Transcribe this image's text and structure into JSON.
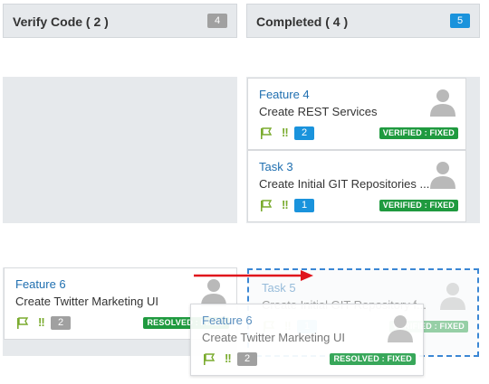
{
  "columns": [
    {
      "title": "Verify Code ( 2 )",
      "count": "4"
    },
    {
      "title": "Completed ( 4 )",
      "count": "5"
    }
  ],
  "completed_cards": [
    {
      "title": "Feature 4",
      "description": "Create REST Services",
      "points": "2",
      "status": "VERIFIED : FIXED"
    },
    {
      "title": "Task 3",
      "description": "Create Initial GIT Repositories ...",
      "points": "1",
      "status": "VERIFIED : FIXED"
    }
  ],
  "verify_card": {
    "title": "Feature 6",
    "description": "Create Twitter Marketing UI",
    "points": "2",
    "status": "RESOLVED : FIXED"
  },
  "ghost_card": {
    "title": "Task 5",
    "description": "Create Initial GIT Repository f...",
    "points": "1",
    "status": "VERIFIED : FIXED"
  },
  "drag_card": {
    "title": "Feature 6",
    "description": "Create Twitter Marketing UI",
    "points": "2",
    "status": "RESOLVED : FIXED"
  },
  "colors": {
    "accent": "#1a93dc",
    "points_gray": "#a0a0a0",
    "status_green": "#1f9a3f",
    "drag_arrow": "#e0141c",
    "dropzone_border": "#3b87d4"
  },
  "icons": {
    "flag": "flag-icon",
    "priority": "priority-icon",
    "avatar": "user-avatar-icon"
  }
}
